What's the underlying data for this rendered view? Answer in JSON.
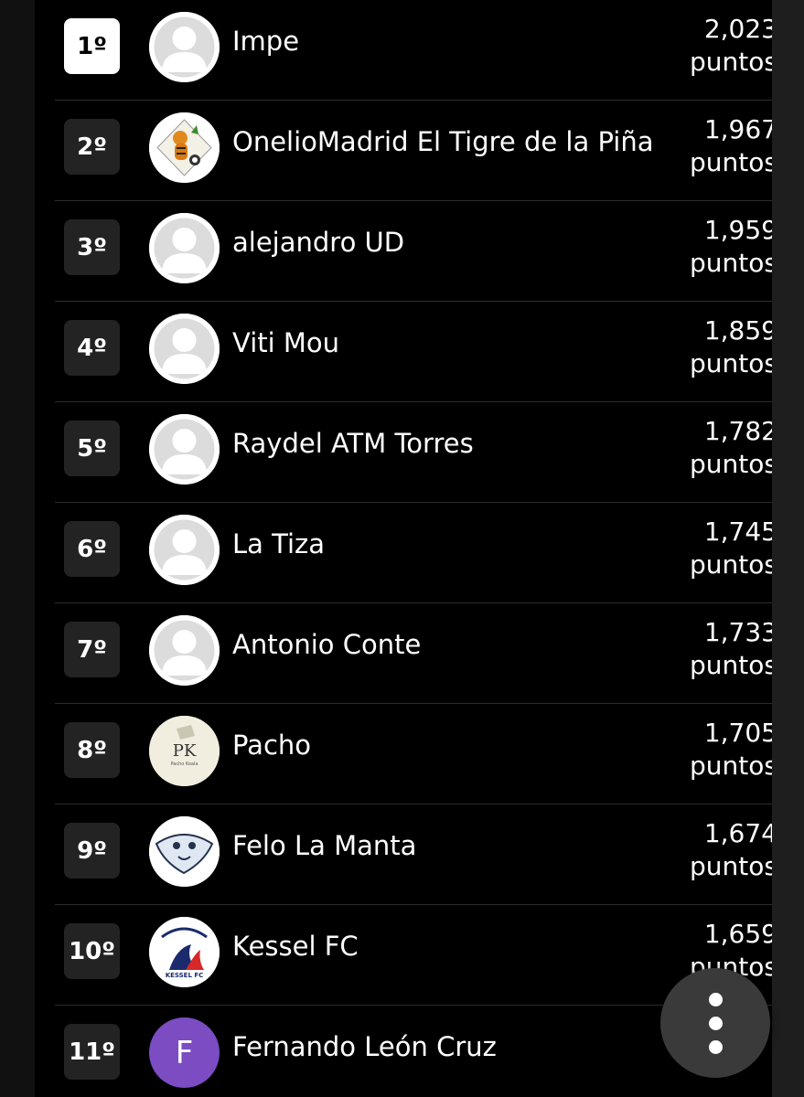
{
  "points_unit": "puntos",
  "rows": [
    {
      "rank": "1º",
      "name": "Impe",
      "points": "2,023",
      "avatar": "default-user-icon"
    },
    {
      "rank": "2º",
      "name": "OnelioMadrid El Tigre de la Piña",
      "points": "1,967",
      "avatar": "tiger-logo"
    },
    {
      "rank": "3º",
      "name": "alejandro UD",
      "points": "1,959",
      "avatar": "default-user-icon"
    },
    {
      "rank": "4º",
      "name": "Viti Mou",
      "points": "1,859",
      "avatar": "default-user-icon"
    },
    {
      "rank": "5º",
      "name": "Raydel ATM Torres",
      "points": "1,782",
      "avatar": "default-user-icon"
    },
    {
      "rank": "6º",
      "name": "La Tiza",
      "points": "1,745",
      "avatar": "default-user-icon"
    },
    {
      "rank": "7º",
      "name": "Antonio Conte",
      "points": "1,733",
      "avatar": "default-user-icon"
    },
    {
      "rank": "8º",
      "name": "Pacho",
      "points": "1,705",
      "avatar": "pk-logo",
      "avatar_text": "PK",
      "avatar_subtext": "Pacho Koala"
    },
    {
      "rank": "9º",
      "name": "Felo La Manta",
      "points": "1,674",
      "avatar": "manta-logo"
    },
    {
      "rank": "10º",
      "name": "Kessel FC",
      "points": "1,659",
      "avatar": "kessel-fc-logo",
      "avatar_text": "KESSEL FC"
    },
    {
      "rank": "11º",
      "name": "Fernando León Cruz",
      "points": "",
      "avatar": "letter",
      "avatar_text": "F"
    }
  ],
  "colors": {
    "background": "#000000",
    "rank_badge": "#232323",
    "rank_badge_first": "#ffffff",
    "letter_avatar": "#7b4cc2",
    "fab": "#3a3a3a"
  },
  "fab_icon": "more-vertical-icon"
}
